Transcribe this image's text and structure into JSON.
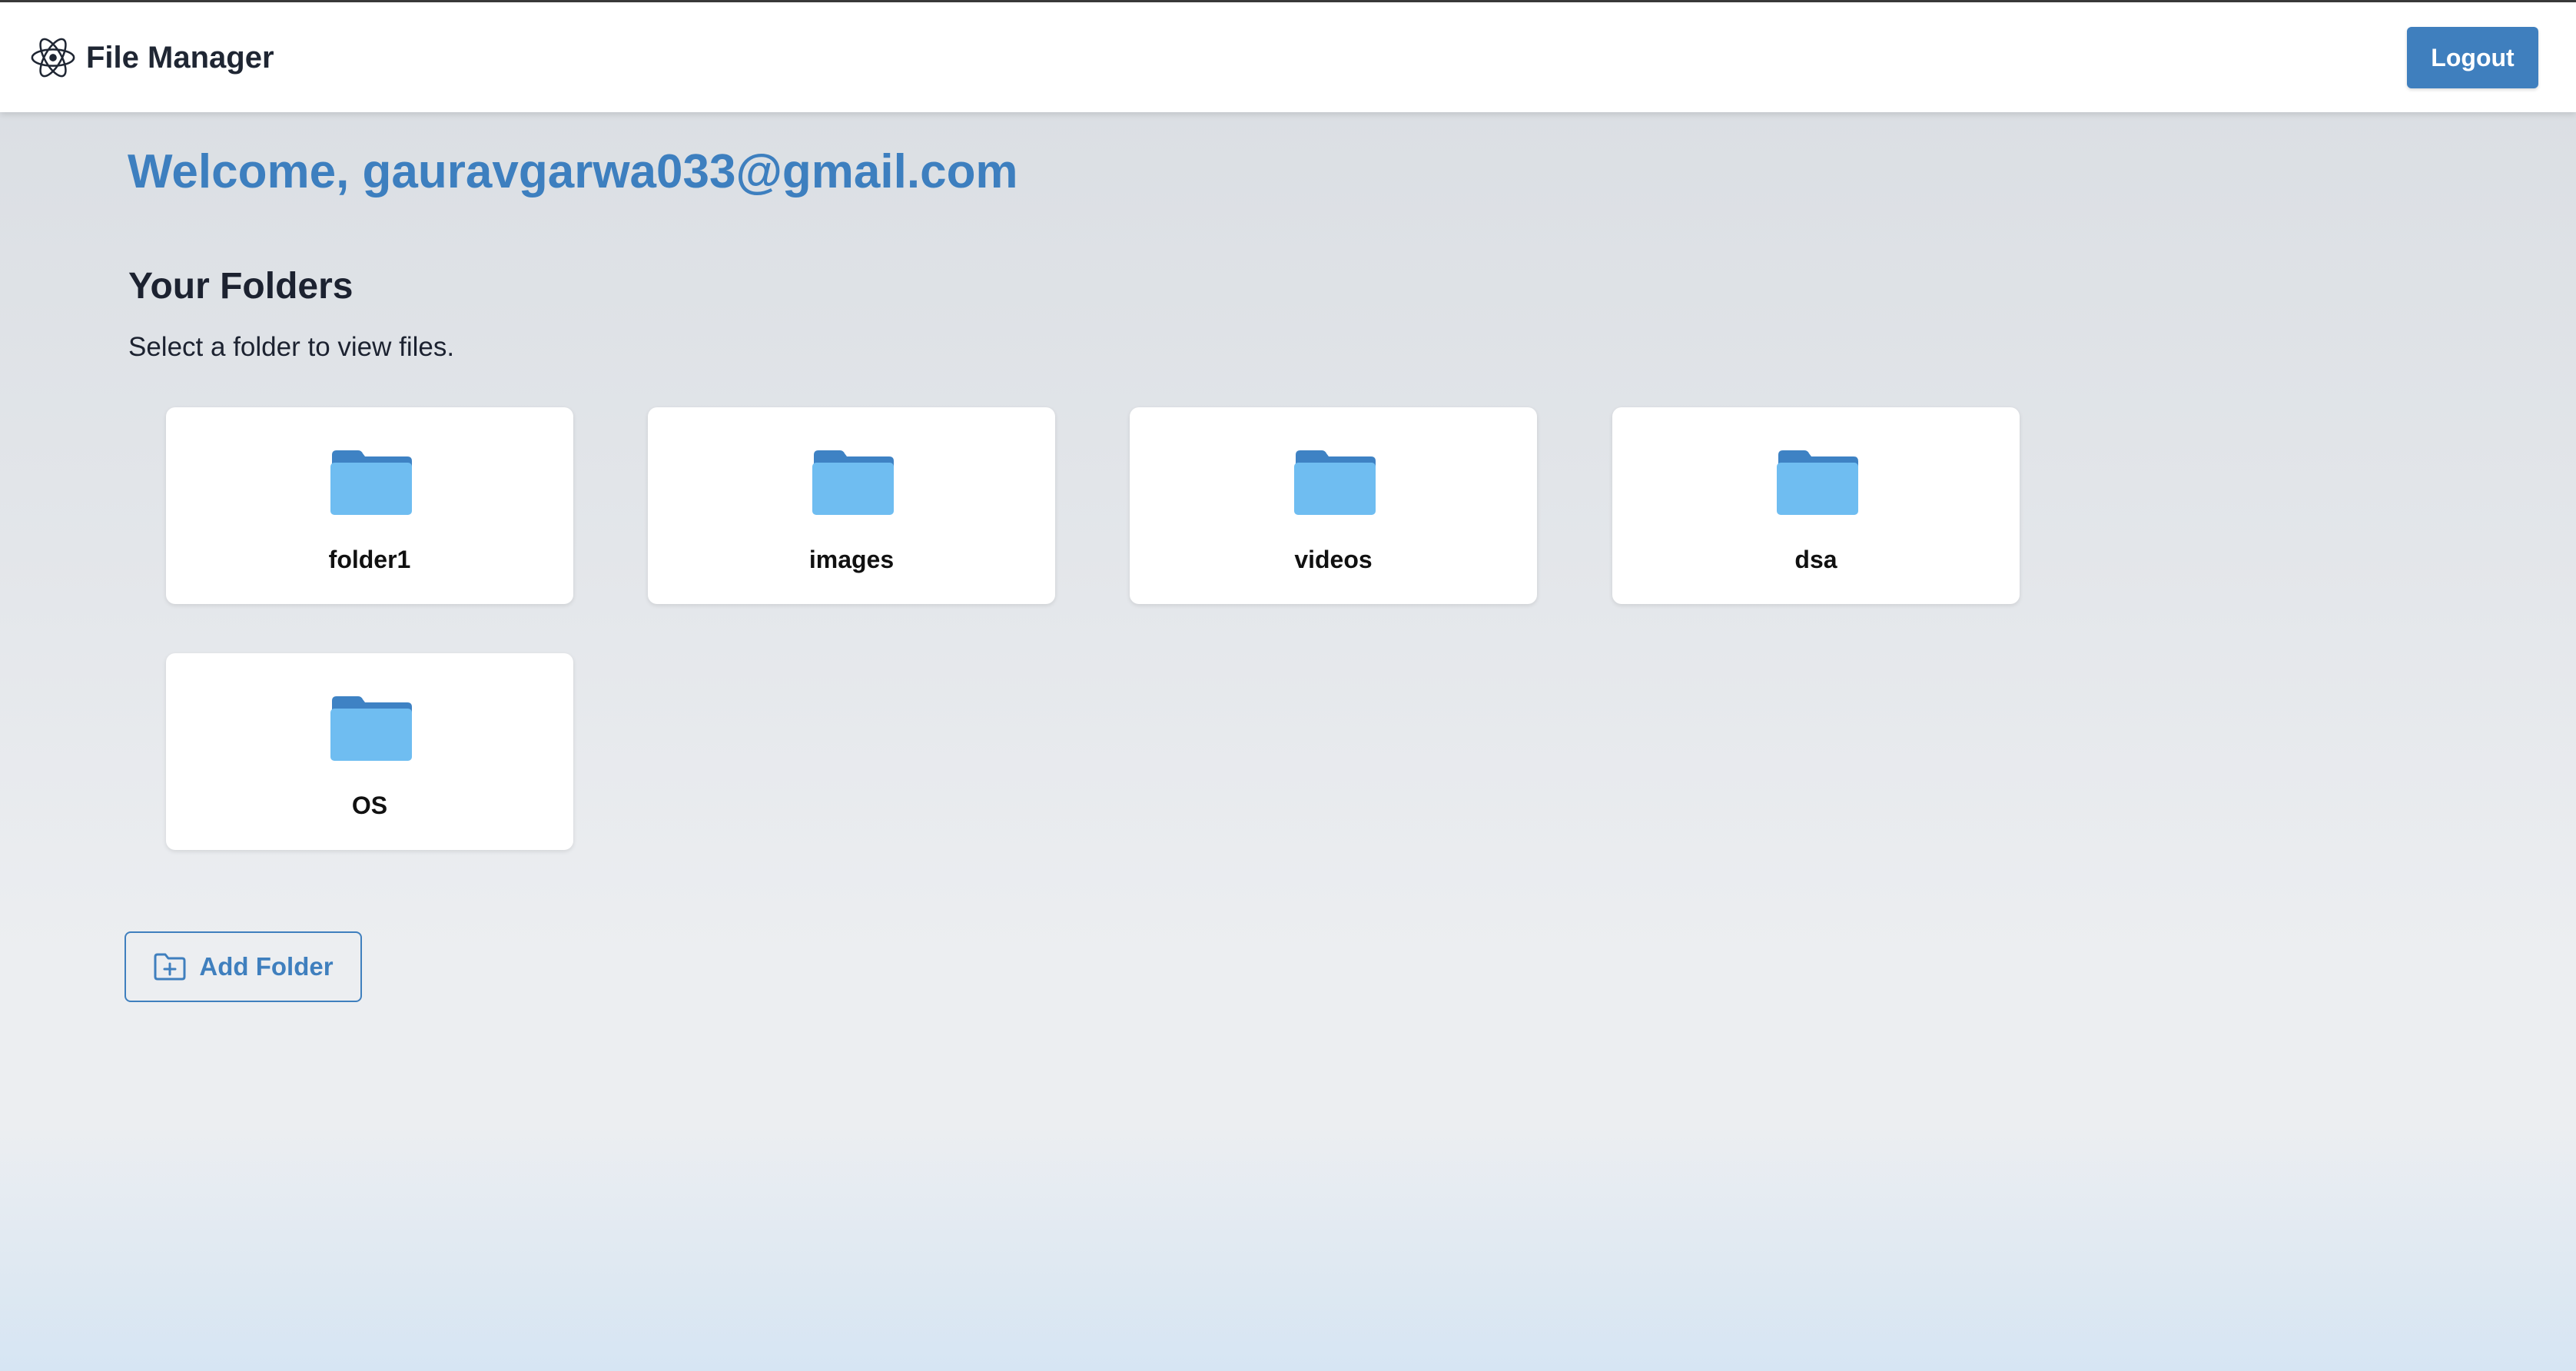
{
  "app": {
    "title": "File Manager",
    "logo_icon": "react-atom-icon"
  },
  "header": {
    "logout_label": "Logout"
  },
  "welcome": {
    "text": "Welcome, gauravgarwa033@gmail.com"
  },
  "folders": {
    "heading": "Your Folders",
    "subtitle": "Select a folder to view files.",
    "items": [
      {
        "name": "folder1"
      },
      {
        "name": "images"
      },
      {
        "name": "videos"
      },
      {
        "name": "dsa"
      },
      {
        "name": "OS"
      }
    ],
    "add_label": "Add Folder",
    "add_icon": "folder-plus-icon",
    "folder_icon": "folder-icon"
  },
  "colors": {
    "accent": "#3f7fbe",
    "folder_front": "#6fbdf1",
    "folder_back": "#3e82c4",
    "card_bg": "#ffffff"
  }
}
